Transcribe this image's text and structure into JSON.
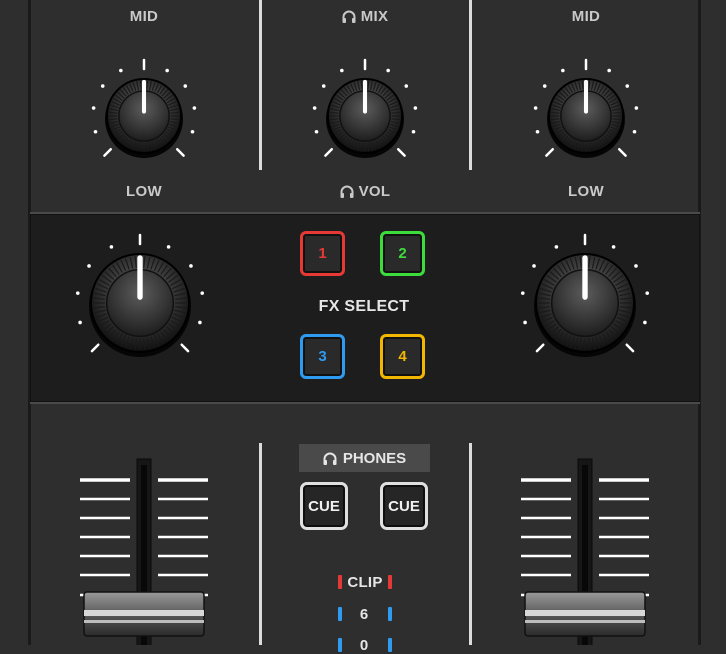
{
  "eq": {
    "left_mid_label": "MID",
    "left_low_label": "LOW",
    "right_mid_label": "MID",
    "right_low_label": "LOW",
    "center_mix_label": "MIX",
    "center_vol_label": "VOL"
  },
  "fx": {
    "select_label": "FX SELECT",
    "buttons": [
      {
        "label": "1",
        "color": "#e53935"
      },
      {
        "label": "2",
        "color": "#3ddc3d"
      },
      {
        "label": "3",
        "color": "#2f9bf0"
      },
      {
        "label": "4",
        "color": "#f2b600"
      }
    ]
  },
  "phones": {
    "label": "PHONES",
    "left_cue_label": "CUE",
    "right_cue_label": "CUE"
  },
  "meter": {
    "clip_label": "CLIP",
    "level_6_label": "6",
    "level_next_label": "0",
    "clip_color": "#e53935",
    "level_color": "#2f9bf0"
  },
  "colors": {
    "panel_bg": "#2e2e2e",
    "fx_strip_bg": "#1d1d1d",
    "scale_white": "#ffffff"
  }
}
